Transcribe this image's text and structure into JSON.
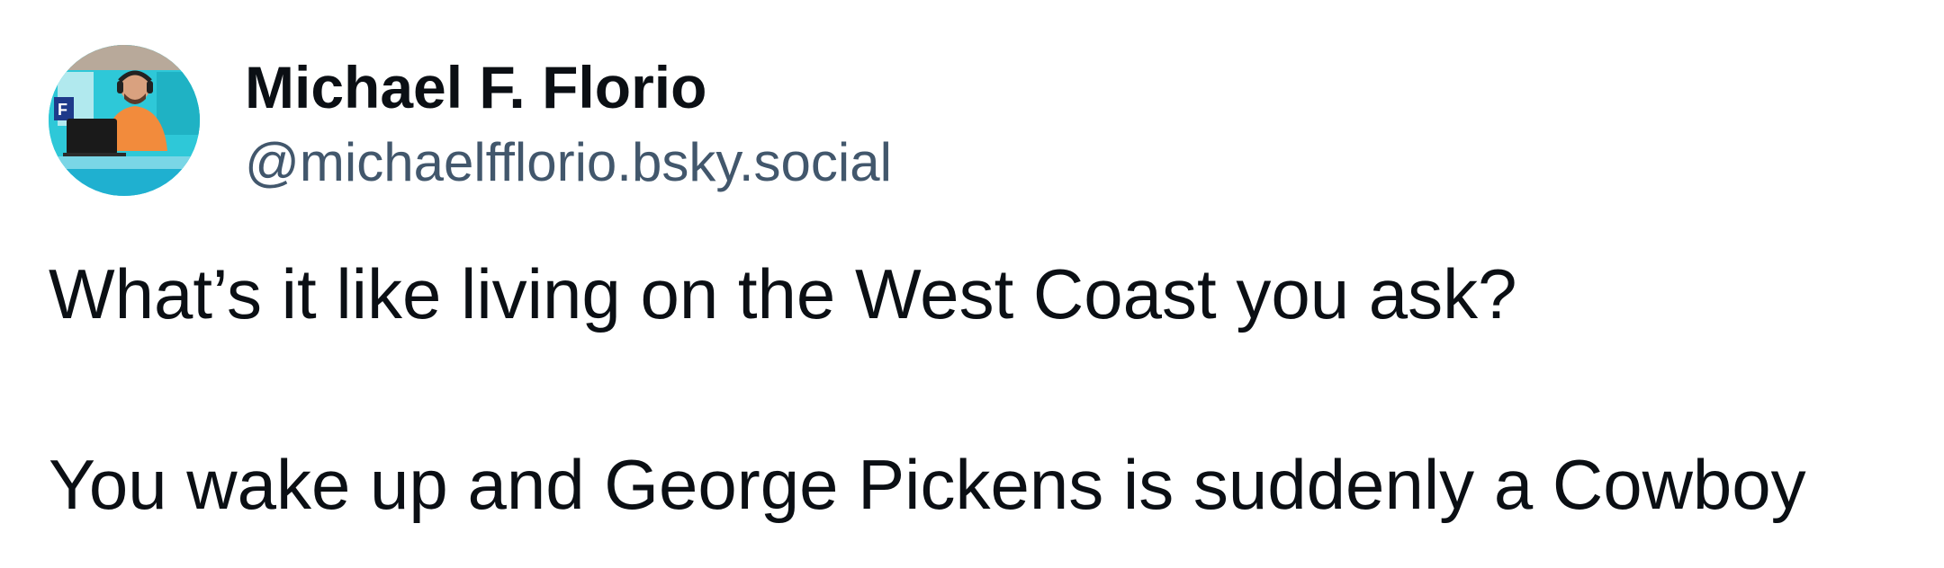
{
  "author": {
    "display_name": "Michael F. Florio",
    "handle": "@michaelfflorio.bsky.social",
    "avatar_icon": "profile-photo"
  },
  "post": {
    "lines": [
      "What’s it like living on the West Coast you ask?",
      "You wake up and George Pickens is suddenly a Cowboy"
    ]
  },
  "colors": {
    "text_primary": "#0b0f14",
    "text_secondary": "#42576c",
    "avatar_bg": "#2ec8d8",
    "shirt": "#f28b3c"
  }
}
